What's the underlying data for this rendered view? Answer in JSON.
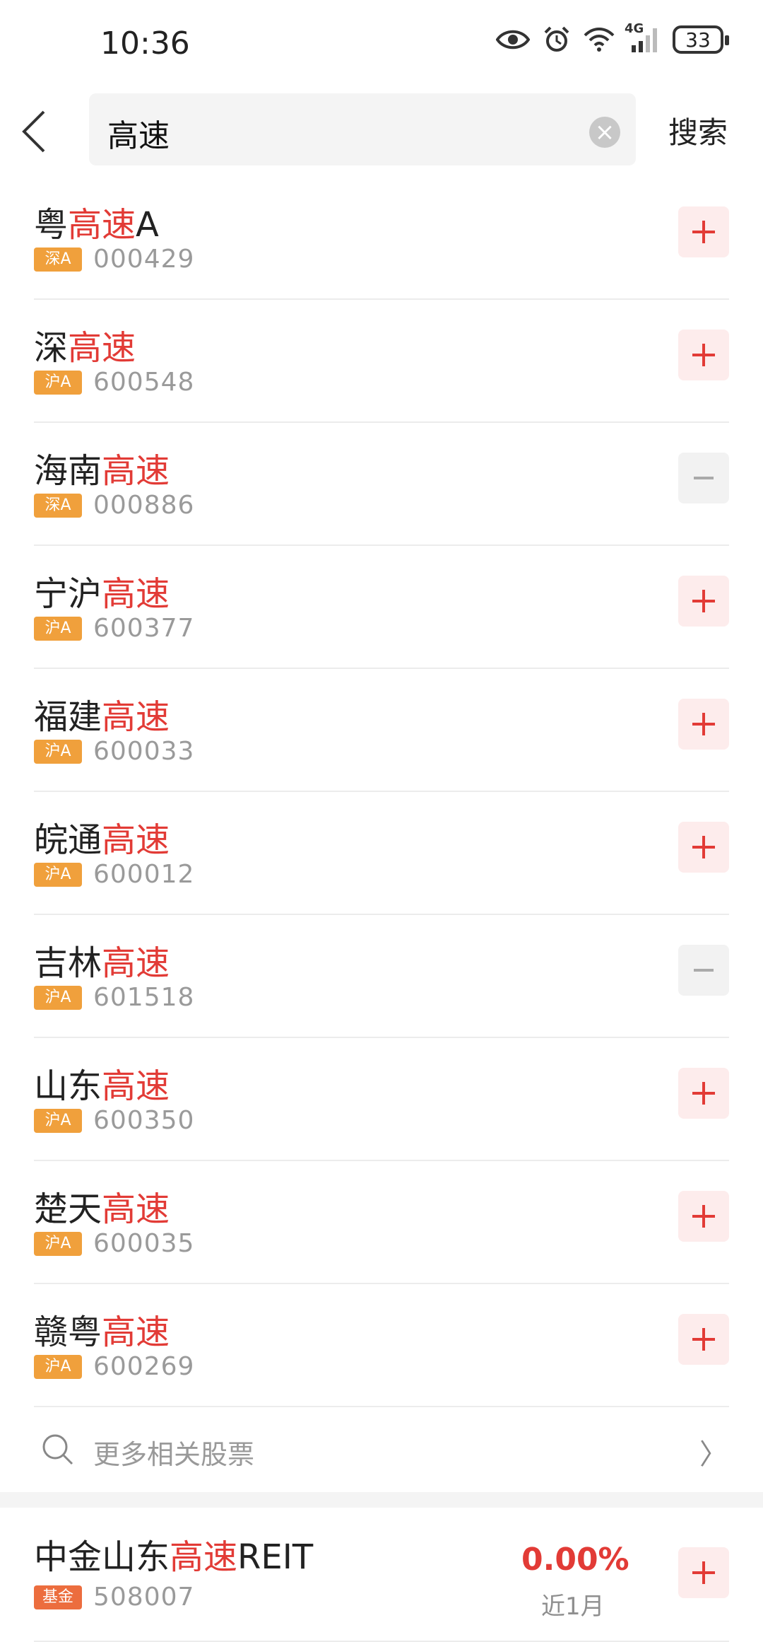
{
  "status_bar": {
    "time": "10:36",
    "network": "4G",
    "battery": "33"
  },
  "header": {
    "query": "高速",
    "search_label": "搜索"
  },
  "results": [
    {
      "prefix": "粤",
      "highlight": "高速",
      "suffix": "A",
      "badge": "深A",
      "code": "000429",
      "action": "add"
    },
    {
      "prefix": "深",
      "highlight": "高速",
      "suffix": "",
      "badge": "沪A",
      "code": "600548",
      "action": "add"
    },
    {
      "prefix": "海南",
      "highlight": "高速",
      "suffix": "",
      "badge": "深A",
      "code": "000886",
      "action": "remove"
    },
    {
      "prefix": "宁沪",
      "highlight": "高速",
      "suffix": "",
      "badge": "沪A",
      "code": "600377",
      "action": "add"
    },
    {
      "prefix": "福建",
      "highlight": "高速",
      "suffix": "",
      "badge": "沪A",
      "code": "600033",
      "action": "add"
    },
    {
      "prefix": "皖通",
      "highlight": "高速",
      "suffix": "",
      "badge": "沪A",
      "code": "600012",
      "action": "add"
    },
    {
      "prefix": "吉林",
      "highlight": "高速",
      "suffix": "",
      "badge": "沪A",
      "code": "601518",
      "action": "remove"
    },
    {
      "prefix": "山东",
      "highlight": "高速",
      "suffix": "",
      "badge": "沪A",
      "code": "600350",
      "action": "add"
    },
    {
      "prefix": "楚天",
      "highlight": "高速",
      "suffix": "",
      "badge": "沪A",
      "code": "600035",
      "action": "add"
    },
    {
      "prefix": "赣粤",
      "highlight": "高速",
      "suffix": "",
      "badge": "沪A",
      "code": "600269",
      "action": "add"
    }
  ],
  "more_link": {
    "label": "更多相关股票"
  },
  "fund": {
    "prefix": "中金山东",
    "highlight": "高速",
    "suffix": "REIT",
    "badge": "基金",
    "code": "508007",
    "change": "0.00%",
    "period": "近1月",
    "action": "add"
  },
  "colors": {
    "highlight": "#e23b36",
    "badge_stock": "#f0a03c",
    "badge_fund": "#ec6d3e"
  }
}
